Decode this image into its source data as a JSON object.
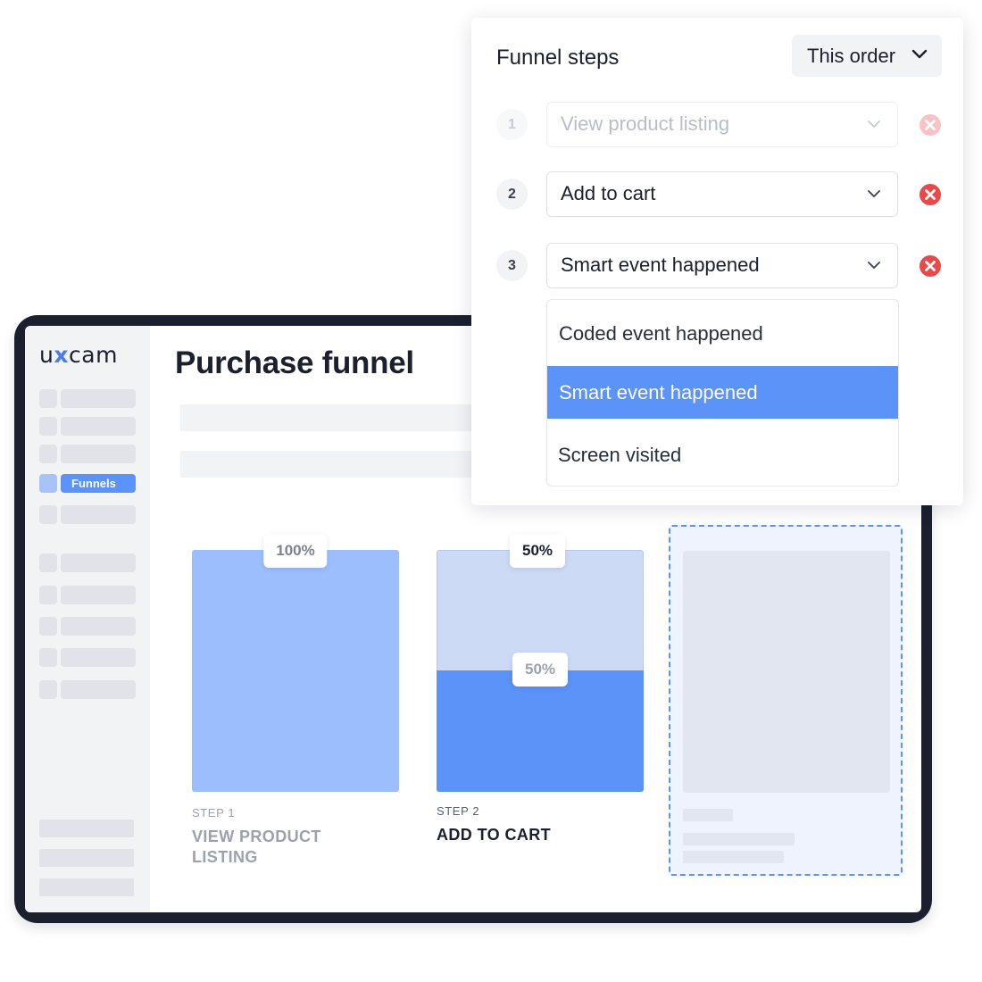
{
  "app": {
    "logo_text_a": "u",
    "logo_text_x": "x",
    "logo_text_b": "cam"
  },
  "sidebar": {
    "active_item": "Funnels"
  },
  "page": {
    "title": "Purchase funnel"
  },
  "funnel": {
    "steps": [
      {
        "step_label": "STEP 1",
        "name_line1": "VIEW PRODUCT",
        "name_line2": "LISTING",
        "percent_label": "100%",
        "percent": 100
      },
      {
        "step_label": "STEP 2",
        "name_line1": "ADD TO CART",
        "total_label": "50%",
        "converted_label": "50%",
        "converted_fraction": 0.5
      }
    ]
  },
  "panel": {
    "title": "Funnel steps",
    "order_label": "This order",
    "steps": [
      {
        "number": "1",
        "value": "View product listing",
        "state": "disabled"
      },
      {
        "number": "2",
        "value": "Add to cart"
      },
      {
        "number": "3",
        "value": "Smart event happened"
      }
    ],
    "dropdown_options": [
      "Coded event happened",
      "Smart event happened",
      "Screen visited"
    ],
    "selected_option": "Smart event happened"
  },
  "colors": {
    "accent": "#5c93f8",
    "bar_light": "#9dbefc",
    "remove_red": "#e8494a",
    "frame": "#1b1f2e"
  },
  "icons": {
    "chevron": "chevron-down-icon",
    "remove": "remove-circle-icon"
  }
}
